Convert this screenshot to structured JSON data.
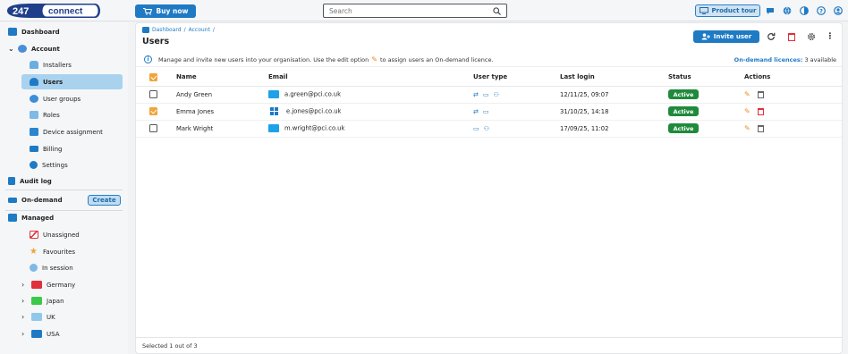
{
  "topbar": {
    "logo_num": "247",
    "logo_word": "connect",
    "buy_label": "Buy now",
    "search_placeholder": "Search",
    "tour_label": "Product tour"
  },
  "sidebar": {
    "dashboard": "Dashboard",
    "account": "Account",
    "installers": "Installers",
    "users": "Users",
    "user_groups": "User groups",
    "roles": "Roles",
    "device_assignment": "Device assignment",
    "billing": "Billing",
    "settings": "Settings",
    "audit_log": "Audit log",
    "on_demand": "On-demand",
    "create": "Create",
    "managed": "Managed",
    "unassigned": "Unassigned",
    "favourites": "Favourites",
    "in_session": "In session",
    "germany": "Germany",
    "japan": "Japan",
    "uk": "UK",
    "usa": "USA"
  },
  "main": {
    "breadcrumb": [
      "Dashboard",
      "Account"
    ],
    "title": "Users",
    "invite_label": "Invite user",
    "info_text_1": "Manage and invite new users into your organisation. Use the edit option",
    "info_text_2": "to assign users an On-demand licence.",
    "licences_label": "On-demand licences:",
    "licences_value": "3 available",
    "columns": [
      "Name",
      "Email",
      "User type",
      "Last login",
      "Status",
      "Actions"
    ],
    "rows": [
      {
        "name": "Andy Green",
        "email": "a.green@pci.co.uk",
        "last_login": "12/11/25, 09:07",
        "status": "Active"
      },
      {
        "name": "Emma Jones",
        "email": "e.jones@pci.co.uk",
        "last_login": "31/10/25, 14:18",
        "status": "Active"
      },
      {
        "name": "Mark Wright",
        "email": "m.wright@pci.co.uk",
        "last_login": "17/09/25, 11:02",
        "status": "Active"
      }
    ],
    "footer": "Selected 1 out of 3"
  },
  "colors": {
    "accent": "#1f7ac4",
    "active_nav": "#a9d2ef",
    "status_active": "#1f8a3b",
    "checkbox_on": "#f0a43a",
    "delete_red": "#e0303a"
  }
}
